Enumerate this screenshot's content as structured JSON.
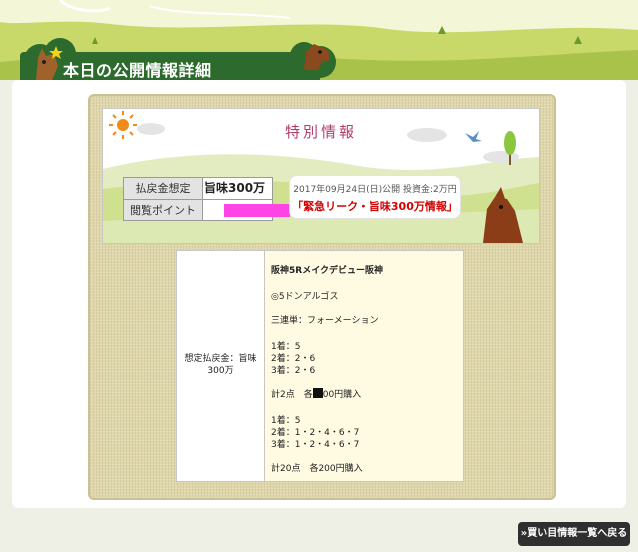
{
  "header": {
    "title": "本日の公開情報詳細"
  },
  "banner": {
    "title": "特別情報",
    "payout_label": "払戻金想定",
    "payout_value": "旨味300万",
    "view_point_label": "閲覧ポイント",
    "date_text": "2017年09月24日(日)公開  投資金:2万円",
    "alert_text": "「緊急リーク・旨味300万情報」",
    "redaction_color": "#ff44e6"
  },
  "detail": {
    "left_label": "想定払戻金：旨味300万",
    "lines": [
      "阪神5Rメイクデビュー阪神",
      "◎5ドンアルゴス",
      "三連単：フォーメーション",
      "1着：5",
      "2着：2・6",
      "3着：2・6",
      "計2点　各",
      "00円購入",
      "1着：5",
      "2着：1・2・4・6・7",
      "3着：1・2・4・6・7",
      "計20点　各200円購入"
    ]
  },
  "nav": {
    "back_label": "»買い目情報一覧へ戻る"
  }
}
